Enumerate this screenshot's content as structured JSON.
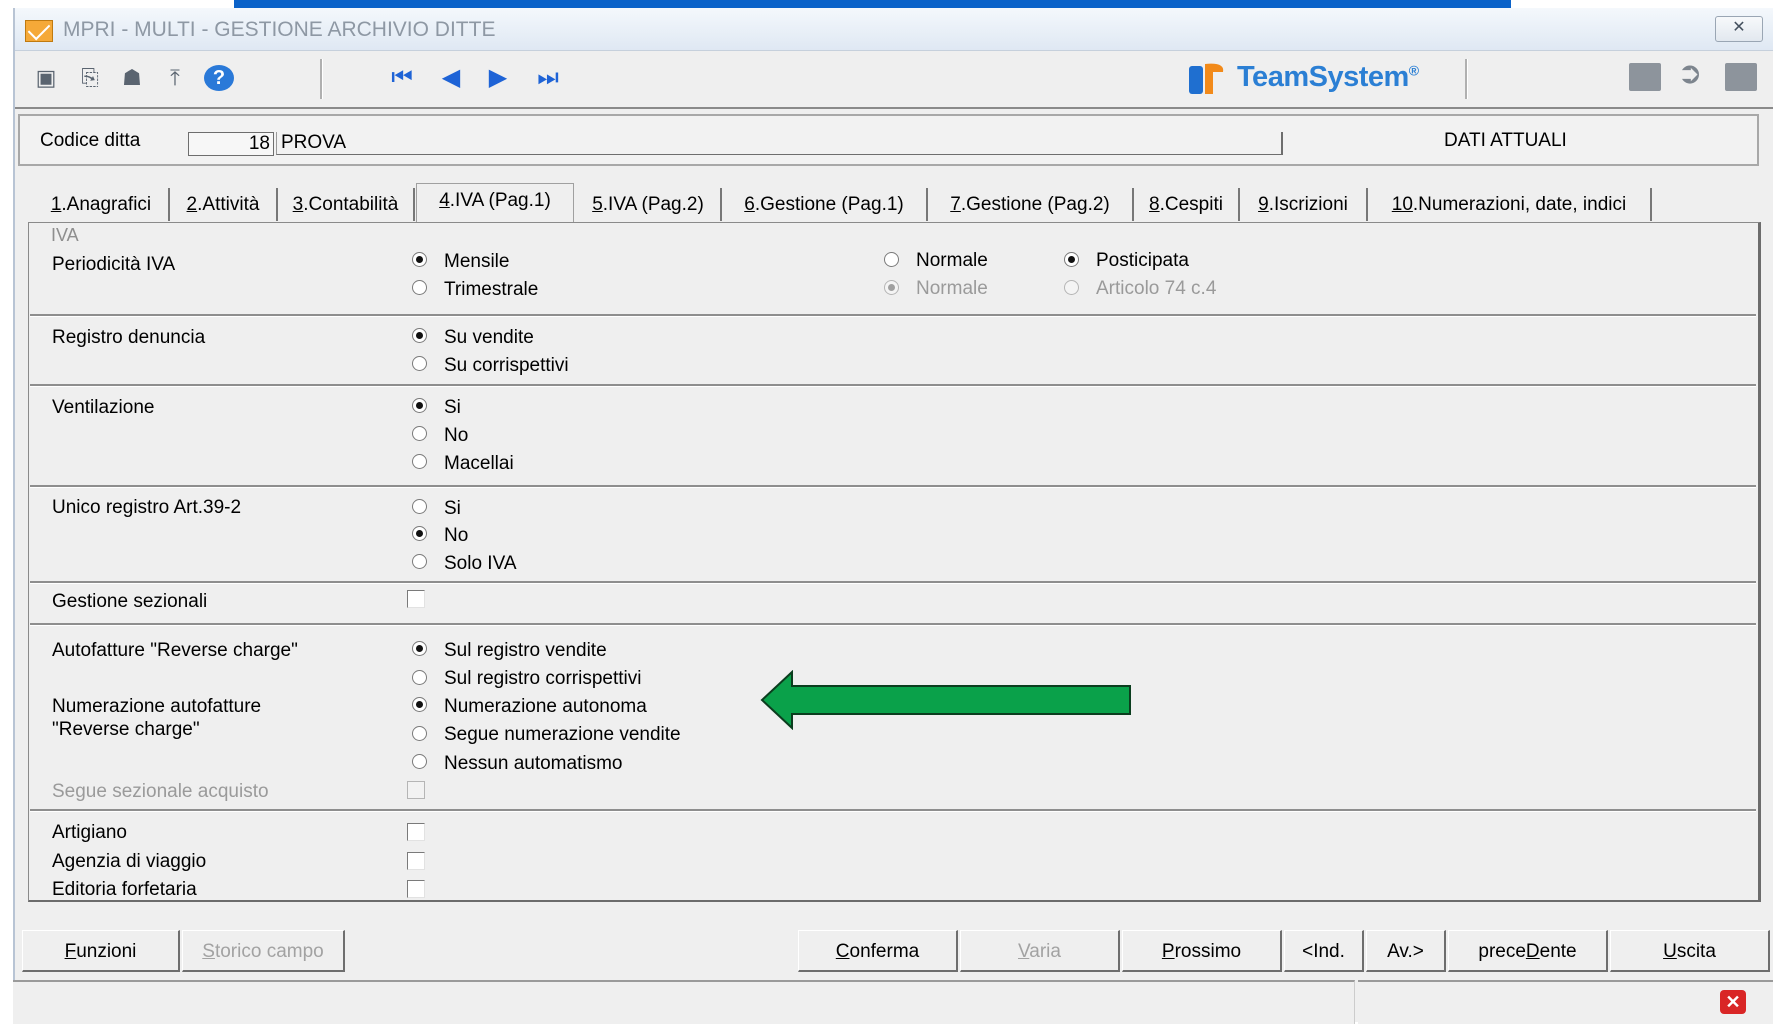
{
  "window": {
    "title": "MPRI  - MULTI -  GESTIONE ARCHIVIO DITTE",
    "close_symbol": "✕"
  },
  "toolbar": {
    "left_icons": [
      "camera-icon",
      "printer-icon",
      "print-preview-icon",
      "upload-icon",
      "help-icon"
    ],
    "nav_icons": [
      "first-record-icon",
      "previous-record-icon",
      "next-record-icon",
      "last-record-icon"
    ],
    "brand": "TeamSystem",
    "brand_mark": "®",
    "right_icons": [
      "save-icon",
      "edit-icon",
      "exit-icon"
    ]
  },
  "header": {
    "company_code_label": "Codice ditta",
    "company_code_value": "18",
    "company_name_value": "PROVA",
    "status": "DATI ATTUALI"
  },
  "tabs": [
    {
      "key": "1",
      "rest": ".Anagrafici"
    },
    {
      "key": "2",
      "rest": ".Attività"
    },
    {
      "key": "3",
      "rest": ".Contabilità"
    },
    {
      "key": "4",
      "rest": ".IVA (Pag.1)",
      "active": true
    },
    {
      "key": "5",
      "rest": ".IVA (Pag.2)"
    },
    {
      "key": "6",
      "rest": ".Gestione (Pag.1)"
    },
    {
      "key": "7",
      "rest": ".Gestione (Pag.2)"
    },
    {
      "key": "8",
      "rest": ".Cespiti"
    },
    {
      "key": "9",
      "rest": ".Iscrizioni"
    },
    {
      "key": "10",
      "rest": ".Numerazioni, date, indici"
    }
  ],
  "group": {
    "legend": "IVA"
  },
  "periodicita": {
    "label": "Periodicità IVA",
    "options": [
      {
        "label": "Mensile",
        "checked": true
      },
      {
        "label": "Trimestrale",
        "checked": false
      }
    ],
    "tipo_options": [
      {
        "label": "Normale",
        "checked": false
      },
      {
        "label": "Normale",
        "checked": true,
        "disabled": true
      }
    ],
    "liquidazione_options": [
      {
        "label": "Posticipata",
        "checked": true
      },
      {
        "label": "Articolo 74 c.4",
        "checked": false,
        "disabled": true
      }
    ]
  },
  "registro_denuncia": {
    "label": "Registro denuncia",
    "options": [
      {
        "label": "Su vendite",
        "checked": true
      },
      {
        "label": "Su corrispettivi",
        "checked": false
      }
    ]
  },
  "ventilazione": {
    "label": "Ventilazione",
    "options": [
      {
        "label": "Si",
        "checked": true
      },
      {
        "label": "No",
        "checked": false
      },
      {
        "label": "Macellai",
        "checked": false
      }
    ]
  },
  "unico_registro": {
    "label": "Unico registro Art.39-2",
    "options": [
      {
        "label": "Si",
        "checked": false
      },
      {
        "label": "No",
        "checked": true
      },
      {
        "label": "Solo IVA",
        "checked": false
      }
    ]
  },
  "gestione_sezionali": {
    "label": "Gestione sezionali",
    "checked": false
  },
  "autofatture": {
    "label": "Autofatture \"Reverse charge\"",
    "options": [
      {
        "label": "Sul registro vendite",
        "checked": true
      },
      {
        "label": "Sul registro corrispettivi",
        "checked": false
      }
    ]
  },
  "numerazione_autofatture": {
    "label_line1": "Numerazione autofatture",
    "label_line2": "\"Reverse charge\"",
    "options": [
      {
        "label": "Numerazione autonoma",
        "checked": true
      },
      {
        "label": "Segue numerazione vendite",
        "checked": false
      },
      {
        "label": "Nessun automatismo",
        "checked": false
      }
    ]
  },
  "segue_sezionale": {
    "label": "Segue sezionale acquisto",
    "checked": false,
    "disabled": true
  },
  "flags": [
    {
      "label": "Artigiano",
      "checked": false
    },
    {
      "label": "Agenzia di viaggio",
      "checked": false
    },
    {
      "label": "Editoria forfetaria",
      "checked": false
    }
  ],
  "annotation": {
    "arrow_color": "#0aa14a",
    "points_to": "Numerazione autonoma"
  },
  "buttons": {
    "funzioni": {
      "key": "F",
      "rest": "unzioni"
    },
    "storico": {
      "key": "S",
      "rest": "torico campo",
      "disabled": true
    },
    "conferma": {
      "key": "C",
      "rest": "onferma"
    },
    "varia": {
      "key": "V",
      "rest": "aria",
      "disabled": true
    },
    "prossimo": {
      "key": "P",
      "rest": "rossimo"
    },
    "ind": {
      "label": "<Ind."
    },
    "av": {
      "label": "Av.>"
    },
    "precedente": {
      "pre": "prece",
      "key": "D",
      "rest": "ente"
    },
    "uscita": {
      "key": "U",
      "rest": "scita"
    }
  },
  "status_bar": {
    "close_symbol": "✕"
  },
  "colors": {
    "accent_blue": "#0a62c9",
    "window_bg": "#efefef",
    "arrow_green": "#0aa14a",
    "status_close": "#d92626"
  }
}
